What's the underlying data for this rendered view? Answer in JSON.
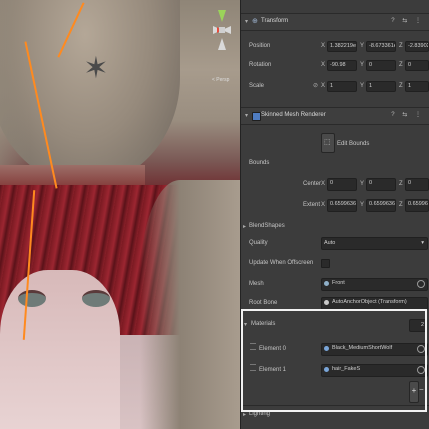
{
  "transform": {
    "title": "Transform",
    "position": {
      "label": "Position",
      "x": "1.382219e-10",
      "y": "-8.673361e-08",
      "z": "-2.839023e-09"
    },
    "rotation": {
      "label": "Rotation",
      "x": "-90.98",
      "y": "0",
      "z": "0"
    },
    "scale": {
      "label": "Scale",
      "x": "1",
      "y": "1",
      "z": "1"
    }
  },
  "axes": {
    "x": "X",
    "y": "Y",
    "z": "Z"
  },
  "scene": {
    "persp_label": "< Persp"
  },
  "skinned": {
    "title": "Skinned Mesh Renderer",
    "edit_bounds": "Edit Bounds",
    "bounds_label": "Bounds",
    "center": {
      "label": "Center",
      "x": "0",
      "y": "0",
      "z": "0"
    },
    "extent": {
      "label": "Extent",
      "x": "0.6599636",
      "y": "0.6599636",
      "z": "0.6599636"
    },
    "blendshapes_label": "BlendShapes",
    "quality": {
      "label": "Quality",
      "value": "Auto"
    },
    "update_offscreen_label": "Update When Offscreen",
    "mesh": {
      "label": "Mesh",
      "value": "Front"
    },
    "root_bone": {
      "label": "Root Bone",
      "value": "AutoAnchorObject (Transform)"
    },
    "materials": {
      "label": "Materials",
      "count": "2",
      "elements": [
        {
          "label": "Element 0",
          "value": "Black_MediumShortWolf"
        },
        {
          "label": "Element 1",
          "value": "hair_FakeS"
        }
      ],
      "add": "+",
      "remove": "−"
    },
    "lighting_label": "Lighting"
  },
  "header_icons": "? ⇆ ⋮",
  "colors": {
    "highlight": "#f2f2f2",
    "accent": "#4f7cc0",
    "orange_outline": "#ff8a1f"
  }
}
